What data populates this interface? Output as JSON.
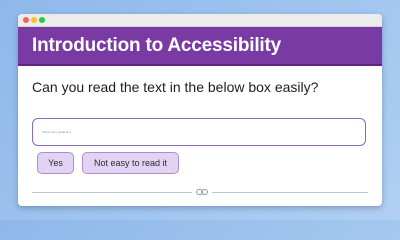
{
  "header": {
    "title": "Introduction to Accessibility"
  },
  "main": {
    "question": "Can you read the text in the below box easily?",
    "sample_text": "This is very small text",
    "buttons": {
      "yes_label": "Yes",
      "no_label": "Not easy to read it"
    }
  },
  "footer": {
    "icon": "link-icon"
  },
  "colors": {
    "header_background": "#7a3aa3",
    "button_background": "#e3d3f3",
    "box_border": "#8e6ab0"
  }
}
